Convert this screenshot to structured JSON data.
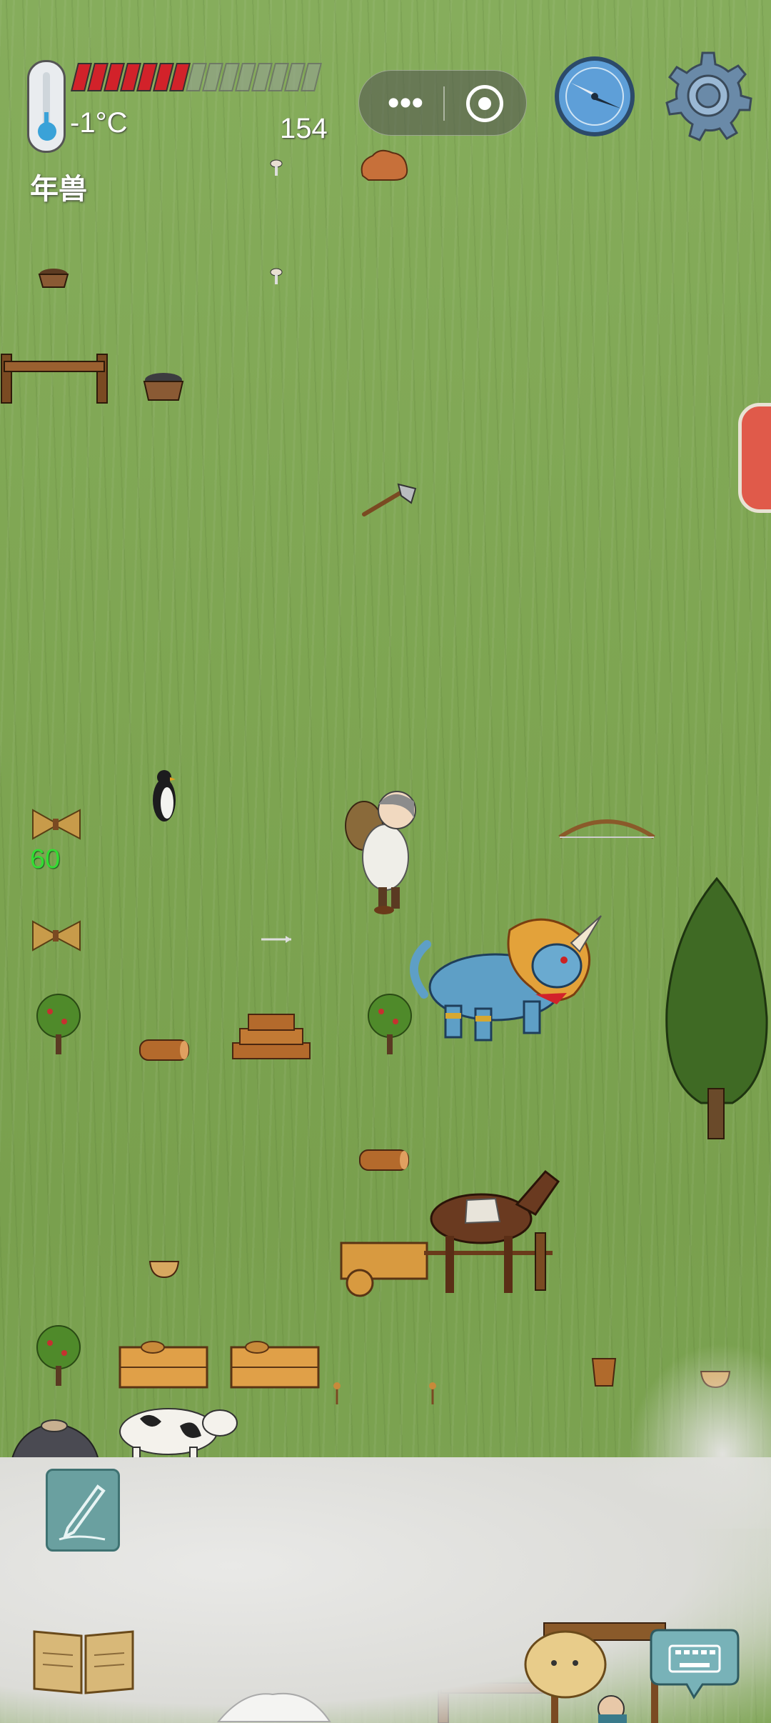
{
  "hud": {
    "temperature": "-1°C",
    "target_name": "年兽",
    "day_counter": "154",
    "health": {
      "filled_segments": 7,
      "total_segments": 15
    },
    "item_count": "60"
  },
  "capsule_menu": {
    "more_icon": "more-dots-icon",
    "close_icon": "record-circle-icon"
  },
  "icons": {
    "thermometer": "thermometer-icon",
    "compass": "compass-icon",
    "settings": "gear-icon",
    "pencil": "pencil-icon",
    "journal": "open-book-icon",
    "keyboard": "keyboard-icon"
  },
  "colors": {
    "health_full": "#d2222a",
    "grass": "#7fa655",
    "count_text": "#33dd33"
  }
}
